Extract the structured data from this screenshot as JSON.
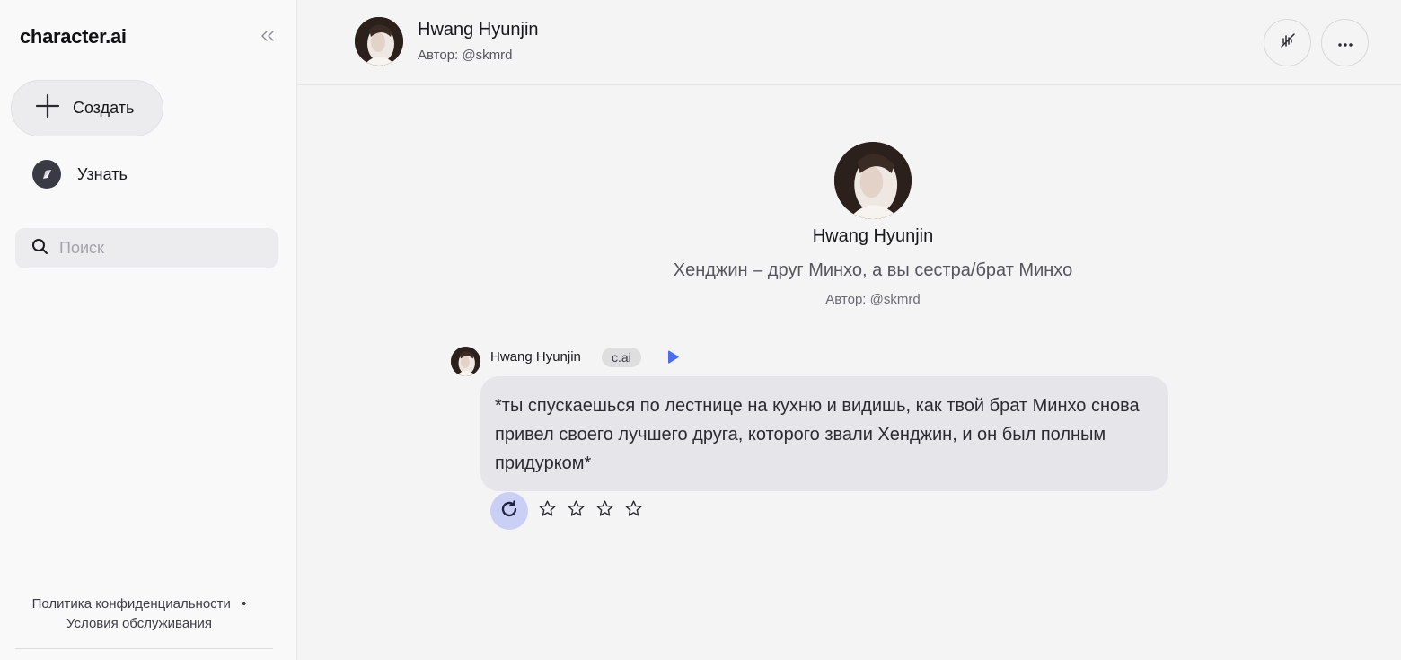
{
  "sidebar": {
    "logo": "character.ai",
    "create_label": "Создать",
    "discover_label": "Узнать",
    "search_placeholder": "Поиск",
    "privacy_link": "Политика конфиденциальности",
    "separator": "•",
    "terms_link": "Условия обслуживания"
  },
  "header": {
    "character_name": "Hwang Hyunjin",
    "author": "Автор: @skmrd"
  },
  "intro": {
    "name": "Hwang Hyunjin",
    "description": "Хенджин – друг Минхо, а вы сестра/брат Минхо",
    "author": "Автор: @skmrd"
  },
  "message": {
    "sender": "Hwang Hyunjin",
    "badge": "c.ai",
    "text": "*ты спускаешься по лестнице на кухню и видишь, как твой брат Минхо снова привел своего лучшего друга, которого звали Хенджин, и он был полным придурком*",
    "rating_max": 4
  },
  "colors": {
    "accent_blue": "#4a6cf7",
    "bubble_bg": "#e5e5ea",
    "regen_bg": "#c9cff5"
  },
  "icons": {
    "collapse": "double-chevron-left-icon",
    "create": "plus-icon",
    "discover": "compass-icon",
    "search": "search-icon",
    "voice_off": "voice-off-icon",
    "more": "more-dots-icon",
    "play": "play-icon",
    "regenerate": "refresh-icon",
    "star": "star-outline-icon"
  }
}
